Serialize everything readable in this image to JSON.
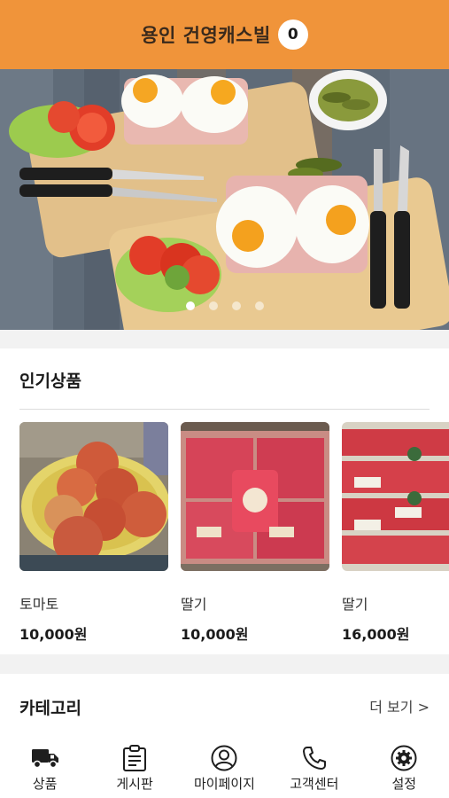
{
  "header": {
    "title": "용인 건영캐스빌",
    "cart_count": "0"
  },
  "banner": {
    "slide_count": 4,
    "active_slide": 1
  },
  "popular": {
    "title": "인기상품",
    "items": [
      {
        "name": "토마토",
        "price": "10,000원",
        "image": "tomato-basket"
      },
      {
        "name": "딸기",
        "price": "10,000원",
        "image": "strawberry-boxes"
      },
      {
        "name": "딸기",
        "price": "16,000원",
        "image": "strawberry-crates"
      }
    ]
  },
  "category": {
    "title": "카테고리",
    "more_label": "더 보기 >"
  },
  "nav": {
    "items": [
      {
        "label": "상품",
        "icon": "truck-icon"
      },
      {
        "label": "게시판",
        "icon": "clipboard-icon"
      },
      {
        "label": "마이페이지",
        "icon": "user-icon"
      },
      {
        "label": "고객센터",
        "icon": "phone-icon"
      },
      {
        "label": "설정",
        "icon": "gear-icon"
      }
    ]
  },
  "colors": {
    "header": "#f0943a",
    "badge_bg": "#ffffff",
    "background": "#f2f2f2"
  }
}
